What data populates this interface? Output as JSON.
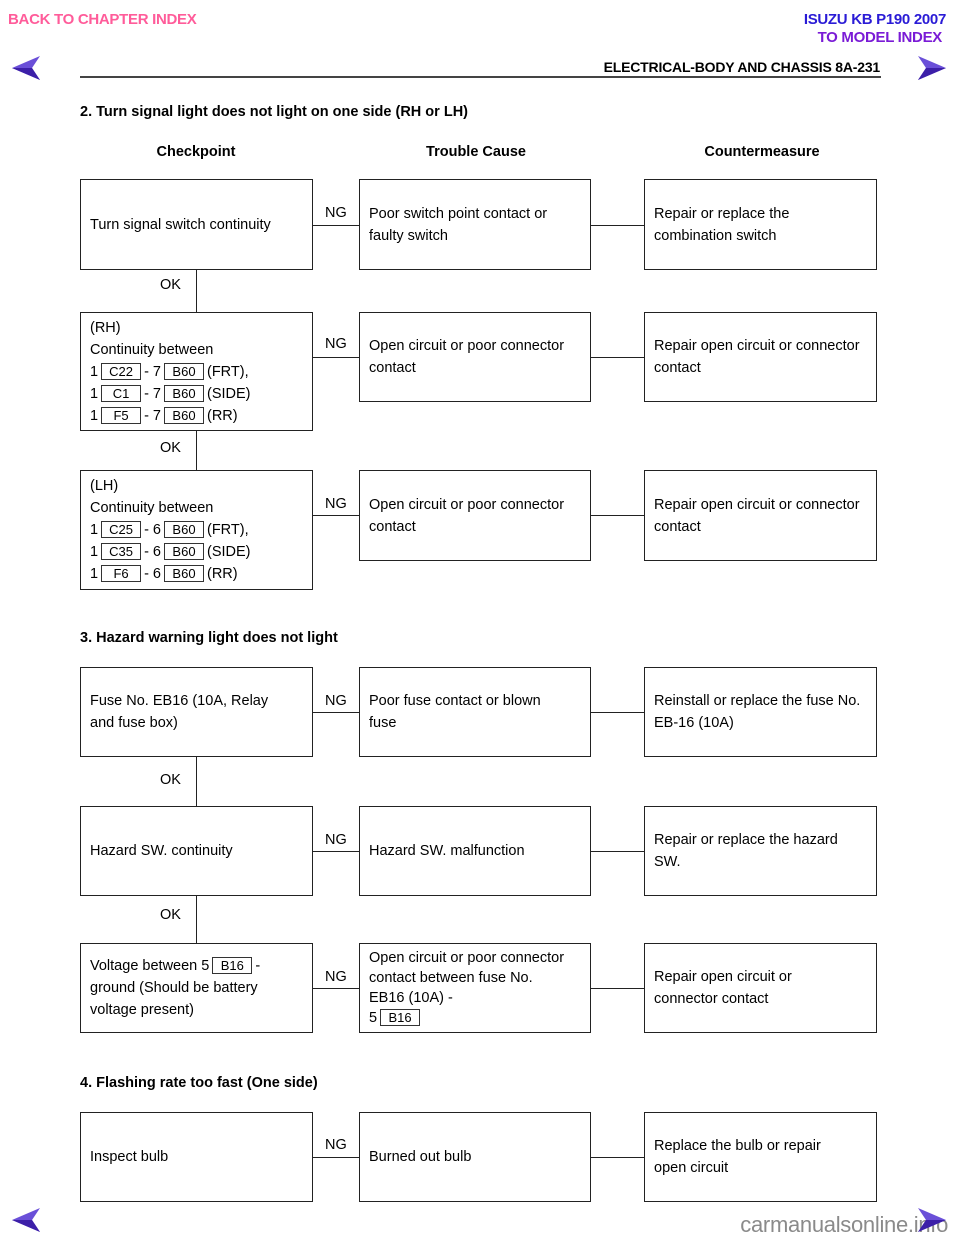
{
  "nav": {
    "back_to_chapter": "BACK TO CHAPTER INDEX",
    "model_title": "ISUZU KB P190 2007",
    "to_model_index": "TO MODEL INDEX",
    "prev_icon": "left-arrow-icon",
    "next_icon": "right-arrow-icon"
  },
  "header": {
    "title": "ELECTRICAL-BODY AND CHASSIS  8A-231"
  },
  "columns": {
    "checkpoint": "Checkpoint",
    "trouble_cause": "Trouble Cause",
    "countermeasure": "Countermeasure"
  },
  "labels": {
    "ng": "NG",
    "ok": "OK"
  },
  "section2": {
    "title": "2.  Turn signal light does not light on one side (RH or LH)",
    "rows": [
      {
        "checkpoint": "Turn signal switch continuity",
        "cause": "Poor switch point contact or faulty switch",
        "counter": "Repair or replace the combination switch"
      },
      {
        "checkpoint_head": "(RH)",
        "checkpoint_sub": "Continuity between",
        "lines": [
          {
            "a": "1",
            "c1": "C22",
            "b": "- 7",
            "c2": "B60",
            "suffix": "(FRT),"
          },
          {
            "a": "1",
            "c1": "C1",
            "b": "- 7",
            "c2": "B60",
            "suffix": "(SIDE)"
          },
          {
            "a": "1",
            "c1": "F5",
            "b": "- 7",
            "c2": "B60",
            "suffix": "(RR)"
          }
        ],
        "cause": "Open circuit or poor connector contact",
        "counter": "Repair open circuit or connector contact"
      },
      {
        "checkpoint_head": "(LH)",
        "checkpoint_sub": "Continuity between",
        "lines": [
          {
            "a": "1",
            "c1": "C25",
            "b": "- 6",
            "c2": "B60",
            "suffix": "(FRT),"
          },
          {
            "a": "1",
            "c1": "C35",
            "b": "- 6",
            "c2": "B60",
            "suffix": "(SIDE)"
          },
          {
            "a": "1",
            "c1": "F6",
            "b": "- 6",
            "c2": "B60",
            "suffix": "(RR)"
          }
        ],
        "cause": "Open circuit or poor connector contact",
        "counter": "Repair open circuit or connector contact"
      }
    ]
  },
  "section3": {
    "title": "3.  Hazard warning light does not light",
    "rows": [
      {
        "checkpoint": "Fuse No. EB16 (10A, Relay and fuse box)",
        "cause": "Poor fuse contact or blown fuse",
        "counter": "Reinstall or replace the fuse No. EB-16 (10A)"
      },
      {
        "checkpoint": "Hazard SW. continuity",
        "cause": "Hazard SW. malfunction",
        "counter": "Repair or replace the hazard SW."
      },
      {
        "checkpoint_pre": "Voltage between 5",
        "checkpoint_conn": "B16",
        "checkpoint_post": "-",
        "checkpoint_rest": "ground (Should be battery voltage present)",
        "cause_text": "Open circuit or poor connector contact between fuse No. EB16 (10A) -",
        "cause_pin": "5",
        "cause_conn": "B16",
        "counter": "Repair open circuit or connector contact"
      }
    ]
  },
  "section4": {
    "title": "4.  Flashing rate too fast (One side)",
    "rows": [
      {
        "checkpoint": "Inspect bulb",
        "cause": "Burned out bulb",
        "counter": "Replace the bulb or repair open circuit"
      }
    ]
  },
  "footer": {
    "watermark": "carmanualsonline.info"
  }
}
